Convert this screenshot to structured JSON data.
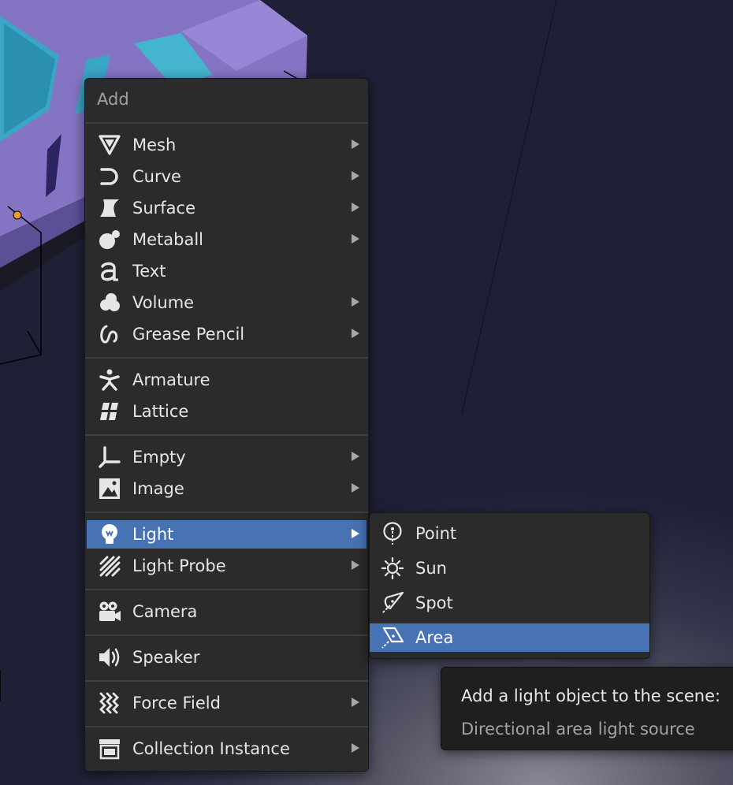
{
  "menu": {
    "title": "Add",
    "items": [
      {
        "label": "Mesh",
        "icon": "mesh-icon",
        "has_submenu": true
      },
      {
        "label": "Curve",
        "icon": "curve-icon",
        "has_submenu": true
      },
      {
        "label": "Surface",
        "icon": "surface-icon",
        "has_submenu": true
      },
      {
        "label": "Metaball",
        "icon": "metaball-icon",
        "has_submenu": true
      },
      {
        "label": "Text",
        "icon": "text-icon",
        "has_submenu": false
      },
      {
        "label": "Volume",
        "icon": "volume-icon",
        "has_submenu": true
      },
      {
        "label": "Grease Pencil",
        "icon": "grease-pencil-icon",
        "has_submenu": true
      },
      {
        "label": "Armature",
        "icon": "armature-icon",
        "has_submenu": false
      },
      {
        "label": "Lattice",
        "icon": "lattice-icon",
        "has_submenu": false
      },
      {
        "label": "Empty",
        "icon": "empty-icon",
        "has_submenu": true
      },
      {
        "label": "Image",
        "icon": "image-icon",
        "has_submenu": true
      },
      {
        "label": "Light",
        "icon": "light-icon",
        "has_submenu": true,
        "active": true
      },
      {
        "label": "Light Probe",
        "icon": "light-probe-icon",
        "has_submenu": true
      },
      {
        "label": "Camera",
        "icon": "camera-icon",
        "has_submenu": false
      },
      {
        "label": "Speaker",
        "icon": "speaker-icon",
        "has_submenu": false
      },
      {
        "label": "Force Field",
        "icon": "force-field-icon",
        "has_submenu": true
      },
      {
        "label": "Collection Instance",
        "icon": "collection-icon",
        "has_submenu": true
      }
    ]
  },
  "light_submenu": {
    "items": [
      {
        "label": "Point",
        "icon": "point-light-icon"
      },
      {
        "label": "Sun",
        "icon": "sun-light-icon"
      },
      {
        "label": "Spot",
        "icon": "spot-light-icon"
      },
      {
        "label": "Area",
        "icon": "area-light-icon",
        "active": true
      }
    ]
  },
  "tooltip": {
    "title": "Add a light object to the scene:",
    "description": "Directional area light source"
  },
  "colors": {
    "menu_bg": "#2b2b2b",
    "highlight": "#4772b3",
    "text": "#e6e6e6",
    "tooltip_bg": "#1f1f1f",
    "car_body": "#8a78c8"
  }
}
